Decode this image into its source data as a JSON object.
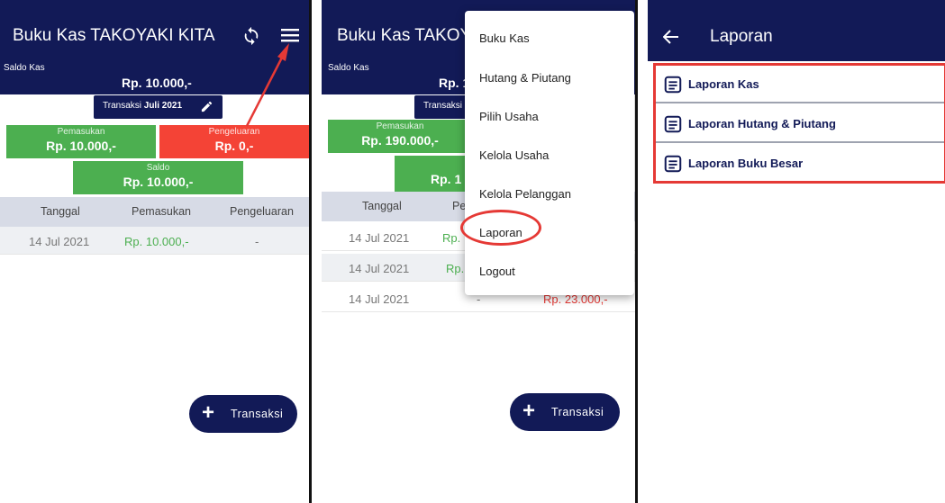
{
  "p1": {
    "title": "Buku Kas TAKOYAKI KITA",
    "saldo_kas_label": "Saldo Kas",
    "saldo_kas_value": "Rp. 10.000,-",
    "transaksi_prefix": "Transaksi",
    "transaksi_month": "Juli 2021",
    "pemasukan_label": "Pemasukan",
    "pemasukan_value": "Rp. 10.000,-",
    "pengeluaran_label": "Pengeluaran",
    "pengeluaran_value": "Rp. 0,-",
    "saldo_label": "Saldo",
    "saldo_value": "Rp. 10.000,-",
    "table": {
      "headers": [
        "Tanggal",
        "Pemasukan",
        "Pengeluaran"
      ],
      "rows": [
        {
          "tanggal": "14 Jul 2021",
          "pemasukan": "Rp. 10.000,-",
          "pengeluaran": "-"
        }
      ]
    },
    "fab_label": "Transaksi"
  },
  "p2": {
    "title": "Buku Kas TAKOY",
    "saldo_kas_label": "Saldo Kas",
    "saldo_kas_value": "Rp. 1",
    "transaksi_prefix": "Transaksi",
    "pemasukan_label": "Pemasukan",
    "pemasukan_value": "Rp. 190.000,-",
    "saldo_value": "Rp. 1",
    "table": {
      "headers": [
        "Tanggal",
        "Pe"
      ],
      "rows": [
        {
          "tanggal": "14 Jul 2021",
          "pemasukan": "Rp.",
          "pengeluaran": ""
        },
        {
          "tanggal": "14 Jul 2021",
          "pemasukan": "Rp.",
          "pengeluaran": ""
        },
        {
          "tanggal": "14 Jul 2021",
          "pemasukan": "-",
          "pengeluaran": "Rp. 23.000,-"
        }
      ]
    },
    "menu_items": [
      "Buku Kas",
      "Hutang & Piutang",
      "Pilih Usaha",
      "Kelola Usaha",
      "Kelola Pelanggan",
      "Laporan",
      "Logout"
    ],
    "fab_label": "Transaksi"
  },
  "p3": {
    "title": "Laporan",
    "reports": [
      "Laporan Kas",
      "Laporan Hutang & Piutang",
      "Laporan Buku Besar"
    ]
  },
  "colors": {
    "navy": "#121a57",
    "green": "#4caf50",
    "red": "#f44336",
    "highlight": "#e53935"
  },
  "icons": [
    "refresh-icon",
    "menu-icon",
    "pencil-icon",
    "plus-icon",
    "back-arrow-icon",
    "document-icon"
  ]
}
